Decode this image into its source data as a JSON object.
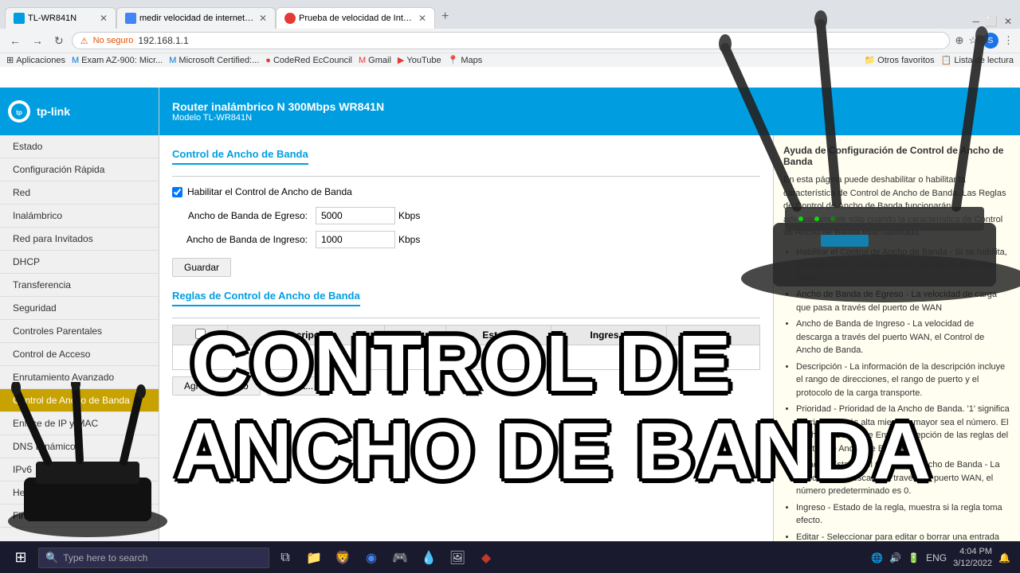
{
  "browser": {
    "tabs": [
      {
        "id": "tab1",
        "label": "TL-WR841N",
        "active": false,
        "favicon": "🔵"
      },
      {
        "id": "tab2",
        "label": "medir velocidad de internet - Bu...",
        "active": false,
        "favicon": "🌐"
      },
      {
        "id": "tab3",
        "label": "Prueba de velocidad de Internet...",
        "active": true,
        "favicon": "🔴"
      }
    ],
    "address": "192.168.1.1",
    "security_label": "No seguro"
  },
  "bookmarks": [
    {
      "label": "Aplicaciones"
    },
    {
      "label": "Exam AZ-900: Micr..."
    },
    {
      "label": "Microsoft Certified:..."
    },
    {
      "label": "CodeRed EcCouncil"
    },
    {
      "label": "Gmail"
    },
    {
      "label": "YouTube"
    },
    {
      "label": "Maps"
    },
    {
      "label": "Otros favoritos"
    },
    {
      "label": "Lista de lectura"
    }
  ],
  "router": {
    "brand": "tp-link",
    "model_line1": "Router inalámbrico N 300Mbps WR841N",
    "model_line2": "Modelo TL-WR841N",
    "sidebar_items": [
      {
        "label": "Estado",
        "active": false
      },
      {
        "label": "Configuración Rápida",
        "active": false
      },
      {
        "label": "Red",
        "active": false
      },
      {
        "label": "Inalámbrico",
        "active": false
      },
      {
        "label": "Red para Invitados",
        "active": false
      },
      {
        "label": "DHCP",
        "active": false
      },
      {
        "label": "Transferencia",
        "active": false
      },
      {
        "label": "Seguridad",
        "active": false
      },
      {
        "label": "Controles Parentales",
        "active": false
      },
      {
        "label": "Control de Acceso",
        "active": false
      },
      {
        "label": "Enrutamiento Avanzado",
        "active": false
      },
      {
        "label": "Control de Ancho de Banda",
        "active": true
      },
      {
        "label": "Enlace de IP y MAC",
        "active": false
      },
      {
        "label": "DNS Dinámico",
        "active": false
      },
      {
        "label": "IPv6",
        "active": false
      },
      {
        "label": "Herramientas del Sistema",
        "active": false
      },
      {
        "label": "Finalizar Sesión",
        "active": false
      }
    ],
    "page_title": "Control de Ancho de Banda",
    "checkbox_label": "Habilitar el Control de Ancho de Banda",
    "egress_label": "Ancho de Banda de Egreso:",
    "egress_value": "5000",
    "egress_unit": "Kbps",
    "ingress_label": "Ancho de Banda de Ingreso:",
    "ingress_value": "1000",
    "ingress_unit": "Kbps",
    "save_button": "Guardar",
    "rules_title": "Reglas de Control de Ancho de Banda",
    "table_headers": [
      "",
      "Descripción",
      "P...",
      "Estado",
      "Ingres...",
      "Editar"
    ],
    "add_button": "Agregar Nuevo",
    "enable_button": "Habilit...",
    "help": {
      "title": "Ayuda de Configuración de Control de Ancho de Banda",
      "paragraphs": [
        "En esta página puede deshabilitar o habilitar la característica de Control de Ancho de Banda. Las Reglas de Control de Ancho de Banda funcionarán adecuadamente sólo cuando la característica de Control de Ancho de Banda esté habilitada.",
        "Habilitar el Control de Ancho de Banda - Si se habilita, las reglas del Control de Ancho de Banda tomarán efecto.",
        "Ancho de Banda de Egreso - La velocidad de carga que pasa a través del puerto de WAN",
        "Ancho de Banda de Ingreso - La velocidad de descarga a través del puerto WAN, el Control de Ancho de Banda.",
        "Descripción - La información de la descripción incluye el rango de direcciones, el rango de puerto y el protocolo de la carga transporte.",
        "Prioridad - Prioridad de la Ancho de Banda. '1' significa la prioridad más alta mientras mayor sea el número. El Ancho de Banda de Envío/Recepción de las reglas del Control de Ancho de Banda.",
        "Estado - Estado del Control de Ancho de Banda - La velocidad de descarga a través del puerto WAN, el número predeterminado es 0.",
        "Ingreso - Estado de la regla, muestra si la regla toma efecto.",
        "Editar - Seleccionar para editar o borrar una entrada existente."
      ]
    }
  },
  "overlay": {
    "line1": "CONTROL DE",
    "line2": "ANCHO DE BANDA"
  },
  "taskbar": {
    "search_placeholder": "Type here to search",
    "time": "4:04 PM",
    "date": "3/12/2022",
    "language": "ENG"
  }
}
